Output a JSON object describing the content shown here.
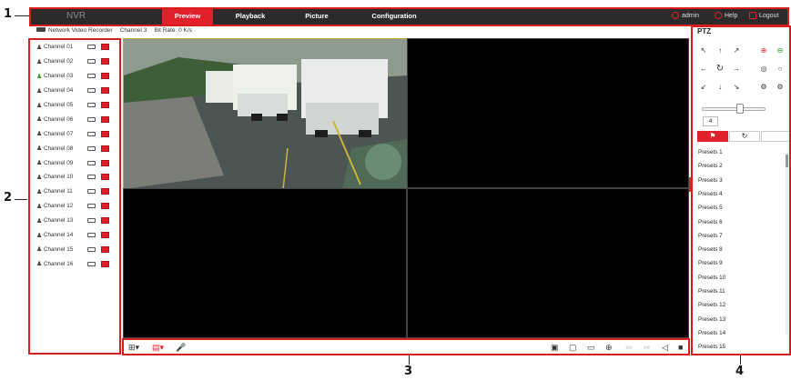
{
  "callouts": [
    "1",
    "2",
    "3",
    "4"
  ],
  "topbar": {
    "logo": "NVR",
    "tabs": [
      {
        "label": "Preview"
      },
      {
        "label": "Playback"
      },
      {
        "label": "Picture"
      },
      {
        "label": "Configuration"
      }
    ],
    "user": "admin",
    "help": "Help",
    "logout": "Logout"
  },
  "info": {
    "device": "Network Video Recorder",
    "channel": "Channel 3",
    "bitrate": "Bit Rate: 0 K/s"
  },
  "channels": [
    "Channel 01",
    "Channel 02",
    "Channel 03",
    "Channel 04",
    "Channel 05",
    "Channel 06",
    "Channel 07",
    "Channel 08",
    "Channel 09",
    "Channel 10",
    "Channel 11",
    "Channel 12",
    "Channel 13",
    "Channel 14",
    "Channel 15",
    "Channel 16"
  ],
  "ptz": {
    "title": "PTZ",
    "speed": "4",
    "presets": [
      "Presets 1",
      "Presets 2",
      "Presets 3",
      "Presets 4",
      "Presets 5",
      "Presets 6",
      "Presets 7",
      "Presets 8",
      "Presets 9",
      "Presets 10",
      "Presets 11",
      "Presets 12",
      "Presets 13",
      "Presets 14",
      "Presets 15"
    ]
  },
  "colors": {
    "accent": "#e0202a",
    "navbar": "#2b2b2b",
    "callout_box": "#d91c1c"
  }
}
